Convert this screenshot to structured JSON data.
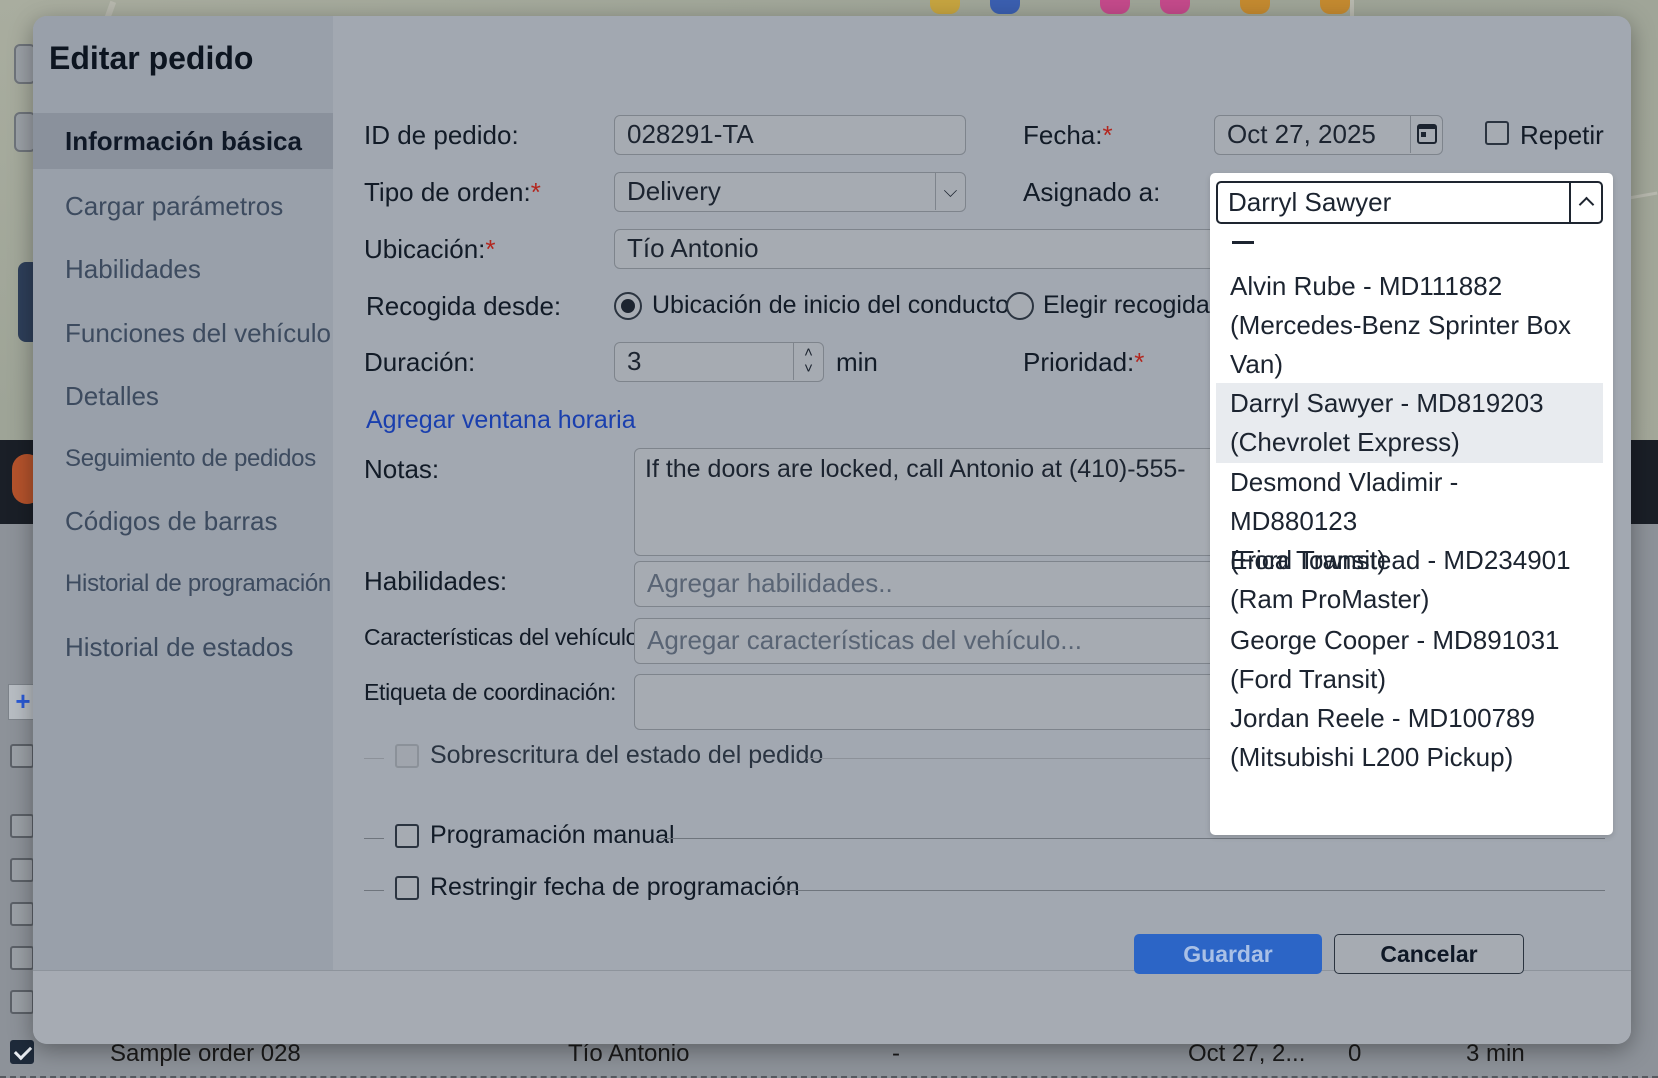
{
  "background": {
    "row": {
      "name": "Sample order 028",
      "location": "Tío Antonio",
      "dash": "-",
      "date": "Oct 27, 2...",
      "count": "0",
      "duration": "3 min"
    }
  },
  "modal": {
    "title": "Editar pedido",
    "sidebar": [
      {
        "label": "Información básica"
      },
      {
        "label": "Cargar parámetros"
      },
      {
        "label": "Habilidades"
      },
      {
        "label": "Funciones del vehículo"
      },
      {
        "label": "Detalles"
      },
      {
        "label": "Seguimiento de pedidos"
      },
      {
        "label": "Códigos de barras"
      },
      {
        "label": "Historial de programación"
      },
      {
        "label": "Historial de estados"
      }
    ],
    "form": {
      "order_id_label": "ID de pedido:",
      "order_id_value": "028291-TA",
      "date_label": "Fecha:",
      "date_value": "Oct 27, 2025",
      "repeat_label": "Repetir",
      "order_type_label": "Tipo de orden:",
      "order_type_value": "Delivery",
      "assigned_label": "Asignado a:",
      "location_label": "Ubicación:",
      "location_value": "Tío Antonio",
      "pickup_label": "Recogida desde:",
      "pickup_option_1": "Ubicación de inicio del conductor",
      "pickup_option_2": "Elegir recogida",
      "duration_label": "Duración:",
      "duration_value": "3",
      "duration_unit": "min",
      "priority_label": "Prioridad:",
      "add_time_window": "Agregar ventana horaria",
      "notes_label": "Notas:",
      "notes_value": "If the doors are locked, call Antonio at (410)-555-",
      "skills_label": "Habilidades:",
      "skills_placeholder": "Agregar habilidades..",
      "vehicle_features_label": "Características del vehículo:",
      "vehicle_features_placeholder": "Agregar características del vehículo...",
      "coordination_label": "Etiqueta de coordinación:",
      "status_override_label": "Sobrescritura del estado del pedido",
      "manual_scheduling_label": "Programación manual",
      "restrict_date_label": "Restringir fecha de programación"
    },
    "footer": {
      "save_label": "Guardar",
      "cancel_label": "Cancelar"
    }
  },
  "assignee_dropdown": {
    "selected": "Darryl Sawyer",
    "empty_option": "—",
    "options": [
      {
        "line1": "Alvin Rube - MD111882",
        "line2": "(Mercedes-Benz Sprinter Box",
        "line3": "Van)"
      },
      {
        "line1": "Darryl Sawyer - MD819203",
        "line2": "(Chevrolet Express)"
      },
      {
        "line1": "Desmond Vladimir - MD880123",
        "line2": "(Ford Transit)"
      },
      {
        "line1": "Erica Townstead - MD234901",
        "line2": "(Ram ProMaster)"
      },
      {
        "line1": "George Cooper - MD891031",
        "line2": "(Ford Transit)"
      },
      {
        "line1": "Jordan Reele - MD100789",
        "line2": "(Mitsubishi L200 Pickup)"
      }
    ],
    "highlighted_index": 1
  },
  "colors": {
    "primary": "#2c65c6",
    "required": "#b3261e",
    "link": "#1a3fae"
  }
}
